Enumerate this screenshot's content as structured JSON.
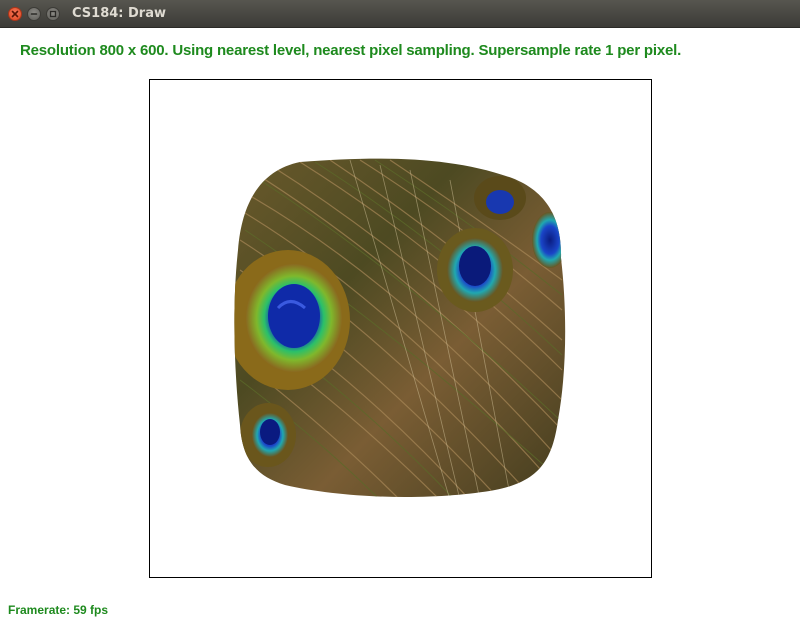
{
  "window": {
    "title": "CS184: Draw"
  },
  "status": {
    "text": "Resolution 800 x 600. Using nearest level, nearest pixel sampling. Supersample rate 1 per pixel."
  },
  "footer": {
    "framerate_text": "Framerate: 59 fps"
  },
  "colors": {
    "status_text": "#1e8a1e",
    "titlebar": "#3c3b37",
    "close_button": "#e0471f"
  },
  "icons": {
    "close": "close-icon",
    "minimize": "minimize-icon",
    "maximize": "maximize-icon"
  }
}
